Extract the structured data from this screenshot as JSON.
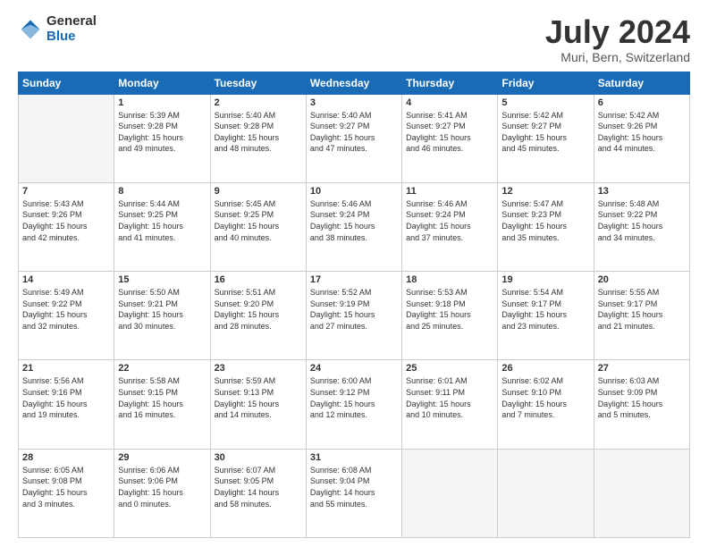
{
  "logo": {
    "general": "General",
    "blue": "Blue"
  },
  "title": "July 2024",
  "subtitle": "Muri, Bern, Switzerland",
  "headers": [
    "Sunday",
    "Monday",
    "Tuesday",
    "Wednesday",
    "Thursday",
    "Friday",
    "Saturday"
  ],
  "weeks": [
    [
      {
        "day": "",
        "content": ""
      },
      {
        "day": "1",
        "content": "Sunrise: 5:39 AM\nSunset: 9:28 PM\nDaylight: 15 hours\nand 49 minutes."
      },
      {
        "day": "2",
        "content": "Sunrise: 5:40 AM\nSunset: 9:28 PM\nDaylight: 15 hours\nand 48 minutes."
      },
      {
        "day": "3",
        "content": "Sunrise: 5:40 AM\nSunset: 9:27 PM\nDaylight: 15 hours\nand 47 minutes."
      },
      {
        "day": "4",
        "content": "Sunrise: 5:41 AM\nSunset: 9:27 PM\nDaylight: 15 hours\nand 46 minutes."
      },
      {
        "day": "5",
        "content": "Sunrise: 5:42 AM\nSunset: 9:27 PM\nDaylight: 15 hours\nand 45 minutes."
      },
      {
        "day": "6",
        "content": "Sunrise: 5:42 AM\nSunset: 9:26 PM\nDaylight: 15 hours\nand 44 minutes."
      }
    ],
    [
      {
        "day": "7",
        "content": "Sunrise: 5:43 AM\nSunset: 9:26 PM\nDaylight: 15 hours\nand 42 minutes."
      },
      {
        "day": "8",
        "content": "Sunrise: 5:44 AM\nSunset: 9:25 PM\nDaylight: 15 hours\nand 41 minutes."
      },
      {
        "day": "9",
        "content": "Sunrise: 5:45 AM\nSunset: 9:25 PM\nDaylight: 15 hours\nand 40 minutes."
      },
      {
        "day": "10",
        "content": "Sunrise: 5:46 AM\nSunset: 9:24 PM\nDaylight: 15 hours\nand 38 minutes."
      },
      {
        "day": "11",
        "content": "Sunrise: 5:46 AM\nSunset: 9:24 PM\nDaylight: 15 hours\nand 37 minutes."
      },
      {
        "day": "12",
        "content": "Sunrise: 5:47 AM\nSunset: 9:23 PM\nDaylight: 15 hours\nand 35 minutes."
      },
      {
        "day": "13",
        "content": "Sunrise: 5:48 AM\nSunset: 9:22 PM\nDaylight: 15 hours\nand 34 minutes."
      }
    ],
    [
      {
        "day": "14",
        "content": "Sunrise: 5:49 AM\nSunset: 9:22 PM\nDaylight: 15 hours\nand 32 minutes."
      },
      {
        "day": "15",
        "content": "Sunrise: 5:50 AM\nSunset: 9:21 PM\nDaylight: 15 hours\nand 30 minutes."
      },
      {
        "day": "16",
        "content": "Sunrise: 5:51 AM\nSunset: 9:20 PM\nDaylight: 15 hours\nand 28 minutes."
      },
      {
        "day": "17",
        "content": "Sunrise: 5:52 AM\nSunset: 9:19 PM\nDaylight: 15 hours\nand 27 minutes."
      },
      {
        "day": "18",
        "content": "Sunrise: 5:53 AM\nSunset: 9:18 PM\nDaylight: 15 hours\nand 25 minutes."
      },
      {
        "day": "19",
        "content": "Sunrise: 5:54 AM\nSunset: 9:17 PM\nDaylight: 15 hours\nand 23 minutes."
      },
      {
        "day": "20",
        "content": "Sunrise: 5:55 AM\nSunset: 9:17 PM\nDaylight: 15 hours\nand 21 minutes."
      }
    ],
    [
      {
        "day": "21",
        "content": "Sunrise: 5:56 AM\nSunset: 9:16 PM\nDaylight: 15 hours\nand 19 minutes."
      },
      {
        "day": "22",
        "content": "Sunrise: 5:58 AM\nSunset: 9:15 PM\nDaylight: 15 hours\nand 16 minutes."
      },
      {
        "day": "23",
        "content": "Sunrise: 5:59 AM\nSunset: 9:13 PM\nDaylight: 15 hours\nand 14 minutes."
      },
      {
        "day": "24",
        "content": "Sunrise: 6:00 AM\nSunset: 9:12 PM\nDaylight: 15 hours\nand 12 minutes."
      },
      {
        "day": "25",
        "content": "Sunrise: 6:01 AM\nSunset: 9:11 PM\nDaylight: 15 hours\nand 10 minutes."
      },
      {
        "day": "26",
        "content": "Sunrise: 6:02 AM\nSunset: 9:10 PM\nDaylight: 15 hours\nand 7 minutes."
      },
      {
        "day": "27",
        "content": "Sunrise: 6:03 AM\nSunset: 9:09 PM\nDaylight: 15 hours\nand 5 minutes."
      }
    ],
    [
      {
        "day": "28",
        "content": "Sunrise: 6:05 AM\nSunset: 9:08 PM\nDaylight: 15 hours\nand 3 minutes."
      },
      {
        "day": "29",
        "content": "Sunrise: 6:06 AM\nSunset: 9:06 PM\nDaylight: 15 hours\nand 0 minutes."
      },
      {
        "day": "30",
        "content": "Sunrise: 6:07 AM\nSunset: 9:05 PM\nDaylight: 14 hours\nand 58 minutes."
      },
      {
        "day": "31",
        "content": "Sunrise: 6:08 AM\nSunset: 9:04 PM\nDaylight: 14 hours\nand 55 minutes."
      },
      {
        "day": "",
        "content": ""
      },
      {
        "day": "",
        "content": ""
      },
      {
        "day": "",
        "content": ""
      }
    ]
  ]
}
